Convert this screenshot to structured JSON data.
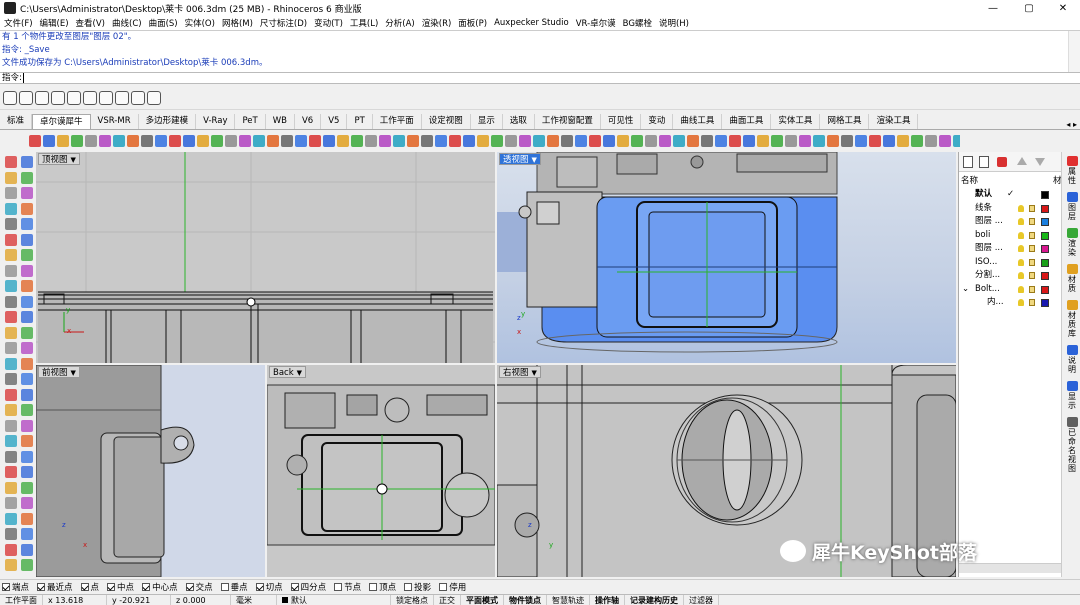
{
  "window": {
    "title": "C:\\Users\\Administrator\\Desktop\\莱卡 006.3dm (25 MB) - Rhinoceros 6 商业版",
    "minimize": "—",
    "maximize": "▢",
    "close": "✕"
  },
  "menu": [
    "文件(F)",
    "编辑(E)",
    "查看(V)",
    "曲线(C)",
    "曲面(S)",
    "实体(O)",
    "网格(M)",
    "尺寸标注(D)",
    "变动(T)",
    "工具(L)",
    "分析(A)",
    "渲染(R)",
    "面板(P)",
    "Auxpecker Studio",
    "VR-卓尔谟",
    "BG螺栓",
    "说明(H)"
  ],
  "command": {
    "history": [
      "有 1 个物件更改至图层\"图层 02\"。",
      "指令: _Save",
      "文件成功保存为 C:\\Users\\Administrator\\Desktop\\莱卡 006.3dm。"
    ],
    "prompt": "指令:"
  },
  "tabs": [
    "标准",
    "卓尔谟犀牛",
    "VSR-MR",
    "多边形建模",
    "V-Ray",
    "PeT",
    "WB",
    "V6",
    "V5",
    "PT",
    "工作平面",
    "设定视图",
    "显示",
    "选取",
    "工作视窗配置",
    "可见性",
    "变动",
    "曲线工具",
    "曲面工具",
    "实体工具",
    "网格工具",
    "渲染工具"
  ],
  "tabs_active": "卓尔谟犀牛",
  "tabs_arrows": "◂ ▸",
  "viewports": {
    "top": "顶视图",
    "perspective": "透视图",
    "front": "前视图",
    "back": "Back",
    "right": "右视图"
  },
  "axis": {
    "x": "x",
    "y": "y",
    "z": "z"
  },
  "panel": {
    "header_name": "名称",
    "header_mat": "材",
    "layers": [
      {
        "name": "默认",
        "check": "✓",
        "color": "#000000",
        "bold": true
      },
      {
        "name": "线条",
        "color": "#d81818"
      },
      {
        "name": "图层 ...",
        "color": "#1a7fe0"
      },
      {
        "name": "boli",
        "color": "#18b818"
      },
      {
        "name": "图层 ...",
        "color": "#d81890"
      },
      {
        "name": "ISO...",
        "color": "#18a018"
      },
      {
        "name": "分割...",
        "color": "#d81818"
      },
      {
        "name": "Bolt...",
        "color": "#d81818",
        "expand": "⌄"
      },
      {
        "name": "内...",
        "color": "#1818b0"
      }
    ],
    "vtabs": [
      "属性",
      "图层",
      "渲染",
      "材质",
      "材质库",
      "说明",
      "显示",
      "已命名视图"
    ]
  },
  "snaps": [
    {
      "label": "端点",
      "on": true
    },
    {
      "label": "最近点",
      "on": true
    },
    {
      "label": "点",
      "on": true
    },
    {
      "label": "中点",
      "on": true
    },
    {
      "label": "中心点",
      "on": true
    },
    {
      "label": "交点",
      "on": true
    },
    {
      "label": "垂点",
      "on": false
    },
    {
      "label": "切点",
      "on": true
    },
    {
      "label": "四分点",
      "on": true
    },
    {
      "label": "节点",
      "on": false
    },
    {
      "label": "顶点",
      "on": false
    },
    {
      "label": "投影",
      "on": false
    },
    {
      "label": "停用",
      "on": false
    }
  ],
  "status": {
    "cplane": "工作平面",
    "x": "x 13.618",
    "y": "y -20.921",
    "z": "z 0.000",
    "unit": "毫米",
    "layer": "默认",
    "grid": "锁定格点",
    "ortho": "正交",
    "planar": "平面模式",
    "osnap": "物件锁点",
    "smarttrack": "智慧轨迹",
    "gumball": "操作轴",
    "history": "记录建构历史",
    "filter": "过滤器"
  },
  "watermark": "犀牛KeyShot部落"
}
